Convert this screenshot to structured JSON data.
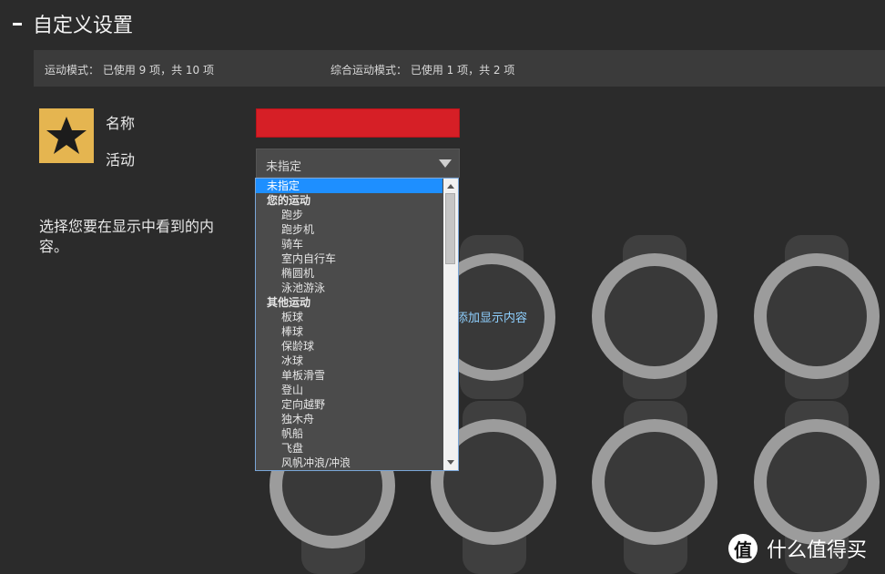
{
  "page": {
    "title": "自定义设置"
  },
  "usage": {
    "sport_modes": "运动模式：  已使用 9 项，共 10 项",
    "multisport_modes": "综合运动模式：  已使用 1 项，共 2 项"
  },
  "form": {
    "name_label": "名称",
    "activity_label": "活动",
    "name_value": "",
    "activity_value": "未指定"
  },
  "hint": "选择您要在显示中看到的内容。",
  "watch": {
    "add_label": "添加显示内容"
  },
  "dropdown": {
    "selected": "未指定",
    "group1": "您的运动",
    "group1_items": [
      "跑步",
      "跑步机",
      "骑车",
      "室内自行车",
      "椭圆机",
      "泳池游泳"
    ],
    "group2": "其他运动",
    "group2_items": [
      "板球",
      "棒球",
      "保龄球",
      "冰球",
      "单板滑雪",
      "登山",
      "定向越野",
      "独木舟",
      "帆船",
      "飞盘",
      "风帆冲浪/冲浪"
    ]
  },
  "watermark": {
    "logo": "值",
    "text": "什么值得买"
  },
  "colors": {
    "accent_star": "#e5b550",
    "name_field": "#d61f26",
    "selection": "#1e8fff",
    "link": "#8fd0ff"
  }
}
